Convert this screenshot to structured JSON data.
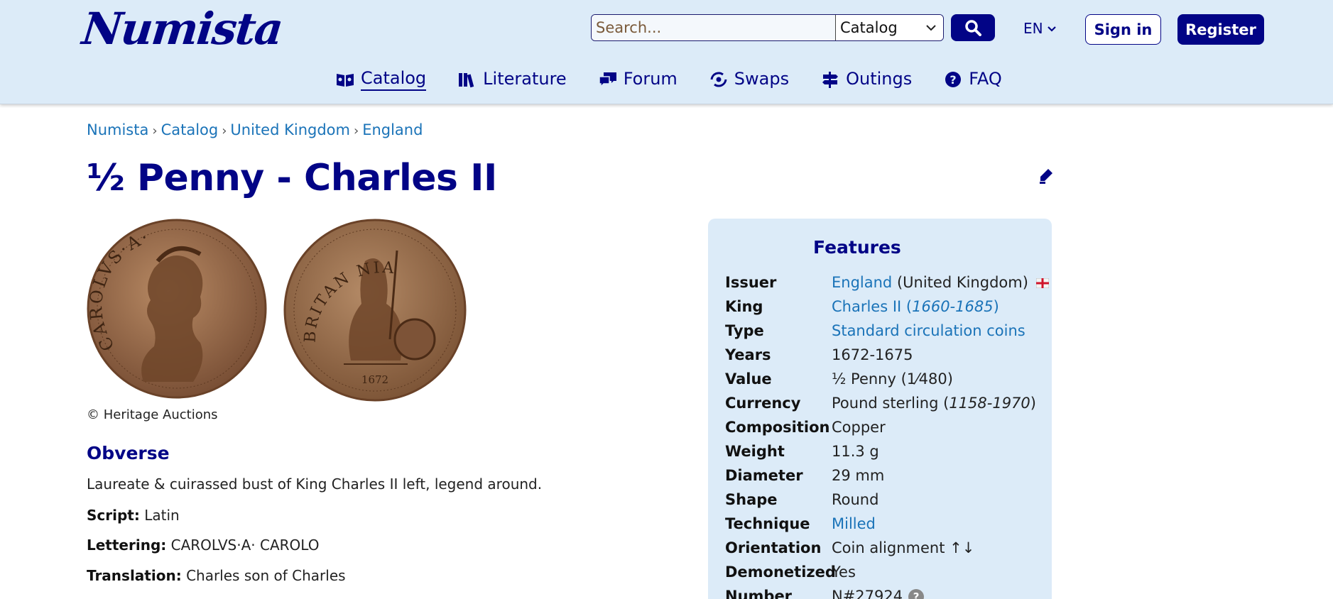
{
  "header": {
    "logo": "Numista",
    "search": {
      "placeholder": "Search...",
      "scope": "Catalog"
    },
    "lang": "EN",
    "signin_label": "Sign in",
    "register_label": "Register"
  },
  "nav": {
    "items": [
      {
        "label": "Catalog",
        "icon": "catalog-book-icon",
        "active": true
      },
      {
        "label": "Literature",
        "icon": "books-icon"
      },
      {
        "label": "Forum",
        "icon": "chat-bubbles-icon"
      },
      {
        "label": "Swaps",
        "icon": "swap-arrows-icon"
      },
      {
        "label": "Outings",
        "icon": "signpost-icon"
      },
      {
        "label": "FAQ",
        "icon": "question-circle-icon"
      }
    ]
  },
  "breadcrumb": [
    "Numista",
    "Catalog",
    "United Kingdom",
    "England"
  ],
  "title": "½ Penny - Charles II",
  "images": {
    "obverse_legend": "CAROLVS·A· CAROLO",
    "reverse_legend": "BRITAN NIA",
    "reverse_year": "1672",
    "copyright": "© Heritage Auctions"
  },
  "obverse": {
    "heading": "Obverse",
    "description": "Laureate & cuirassed bust of King Charles II left, legend around.",
    "script_label": "Script:",
    "script": "Latin",
    "lettering_label": "Lettering:",
    "lettering": "CAROLVS·A· CAROLO",
    "translation_label": "Translation:",
    "translation": "Charles son of Charles"
  },
  "features": {
    "title": "Features",
    "issuer_key": "Issuer",
    "issuer_link": "England",
    "issuer_rest": "(United Kingdom)",
    "king_key": "King",
    "king_link": "Charles II",
    "king_years": "1660-1685",
    "type_key": "Type",
    "type_val": "Standard circulation coins",
    "years_key": "Years",
    "years_val": "1672-1675",
    "value_key": "Value",
    "value_val": "½ Penny",
    "value_frac": "1⁄480",
    "currency_key": "Currency",
    "currency_val": "Pound sterling",
    "currency_years": "1158-1970",
    "composition_key": "Composition",
    "composition_val": "Copper",
    "weight_key": "Weight",
    "weight_val": "11.3 g",
    "diameter_key": "Diameter",
    "diameter_val": "29 mm",
    "shape_key": "Shape",
    "shape_val": "Round",
    "technique_key": "Technique",
    "technique_val": "Milled",
    "orientation_key": "Orientation",
    "orientation_val": "Coin alignment ↑↓",
    "demonetized_key": "Demonetized",
    "demonetized_val": "Yes",
    "number_key": "Number",
    "number_val": "N#27924"
  },
  "colors": {
    "brand": "#020486",
    "link": "#1a73b8",
    "header_bg": "#dcebf8",
    "coin": "#9a6a44"
  }
}
